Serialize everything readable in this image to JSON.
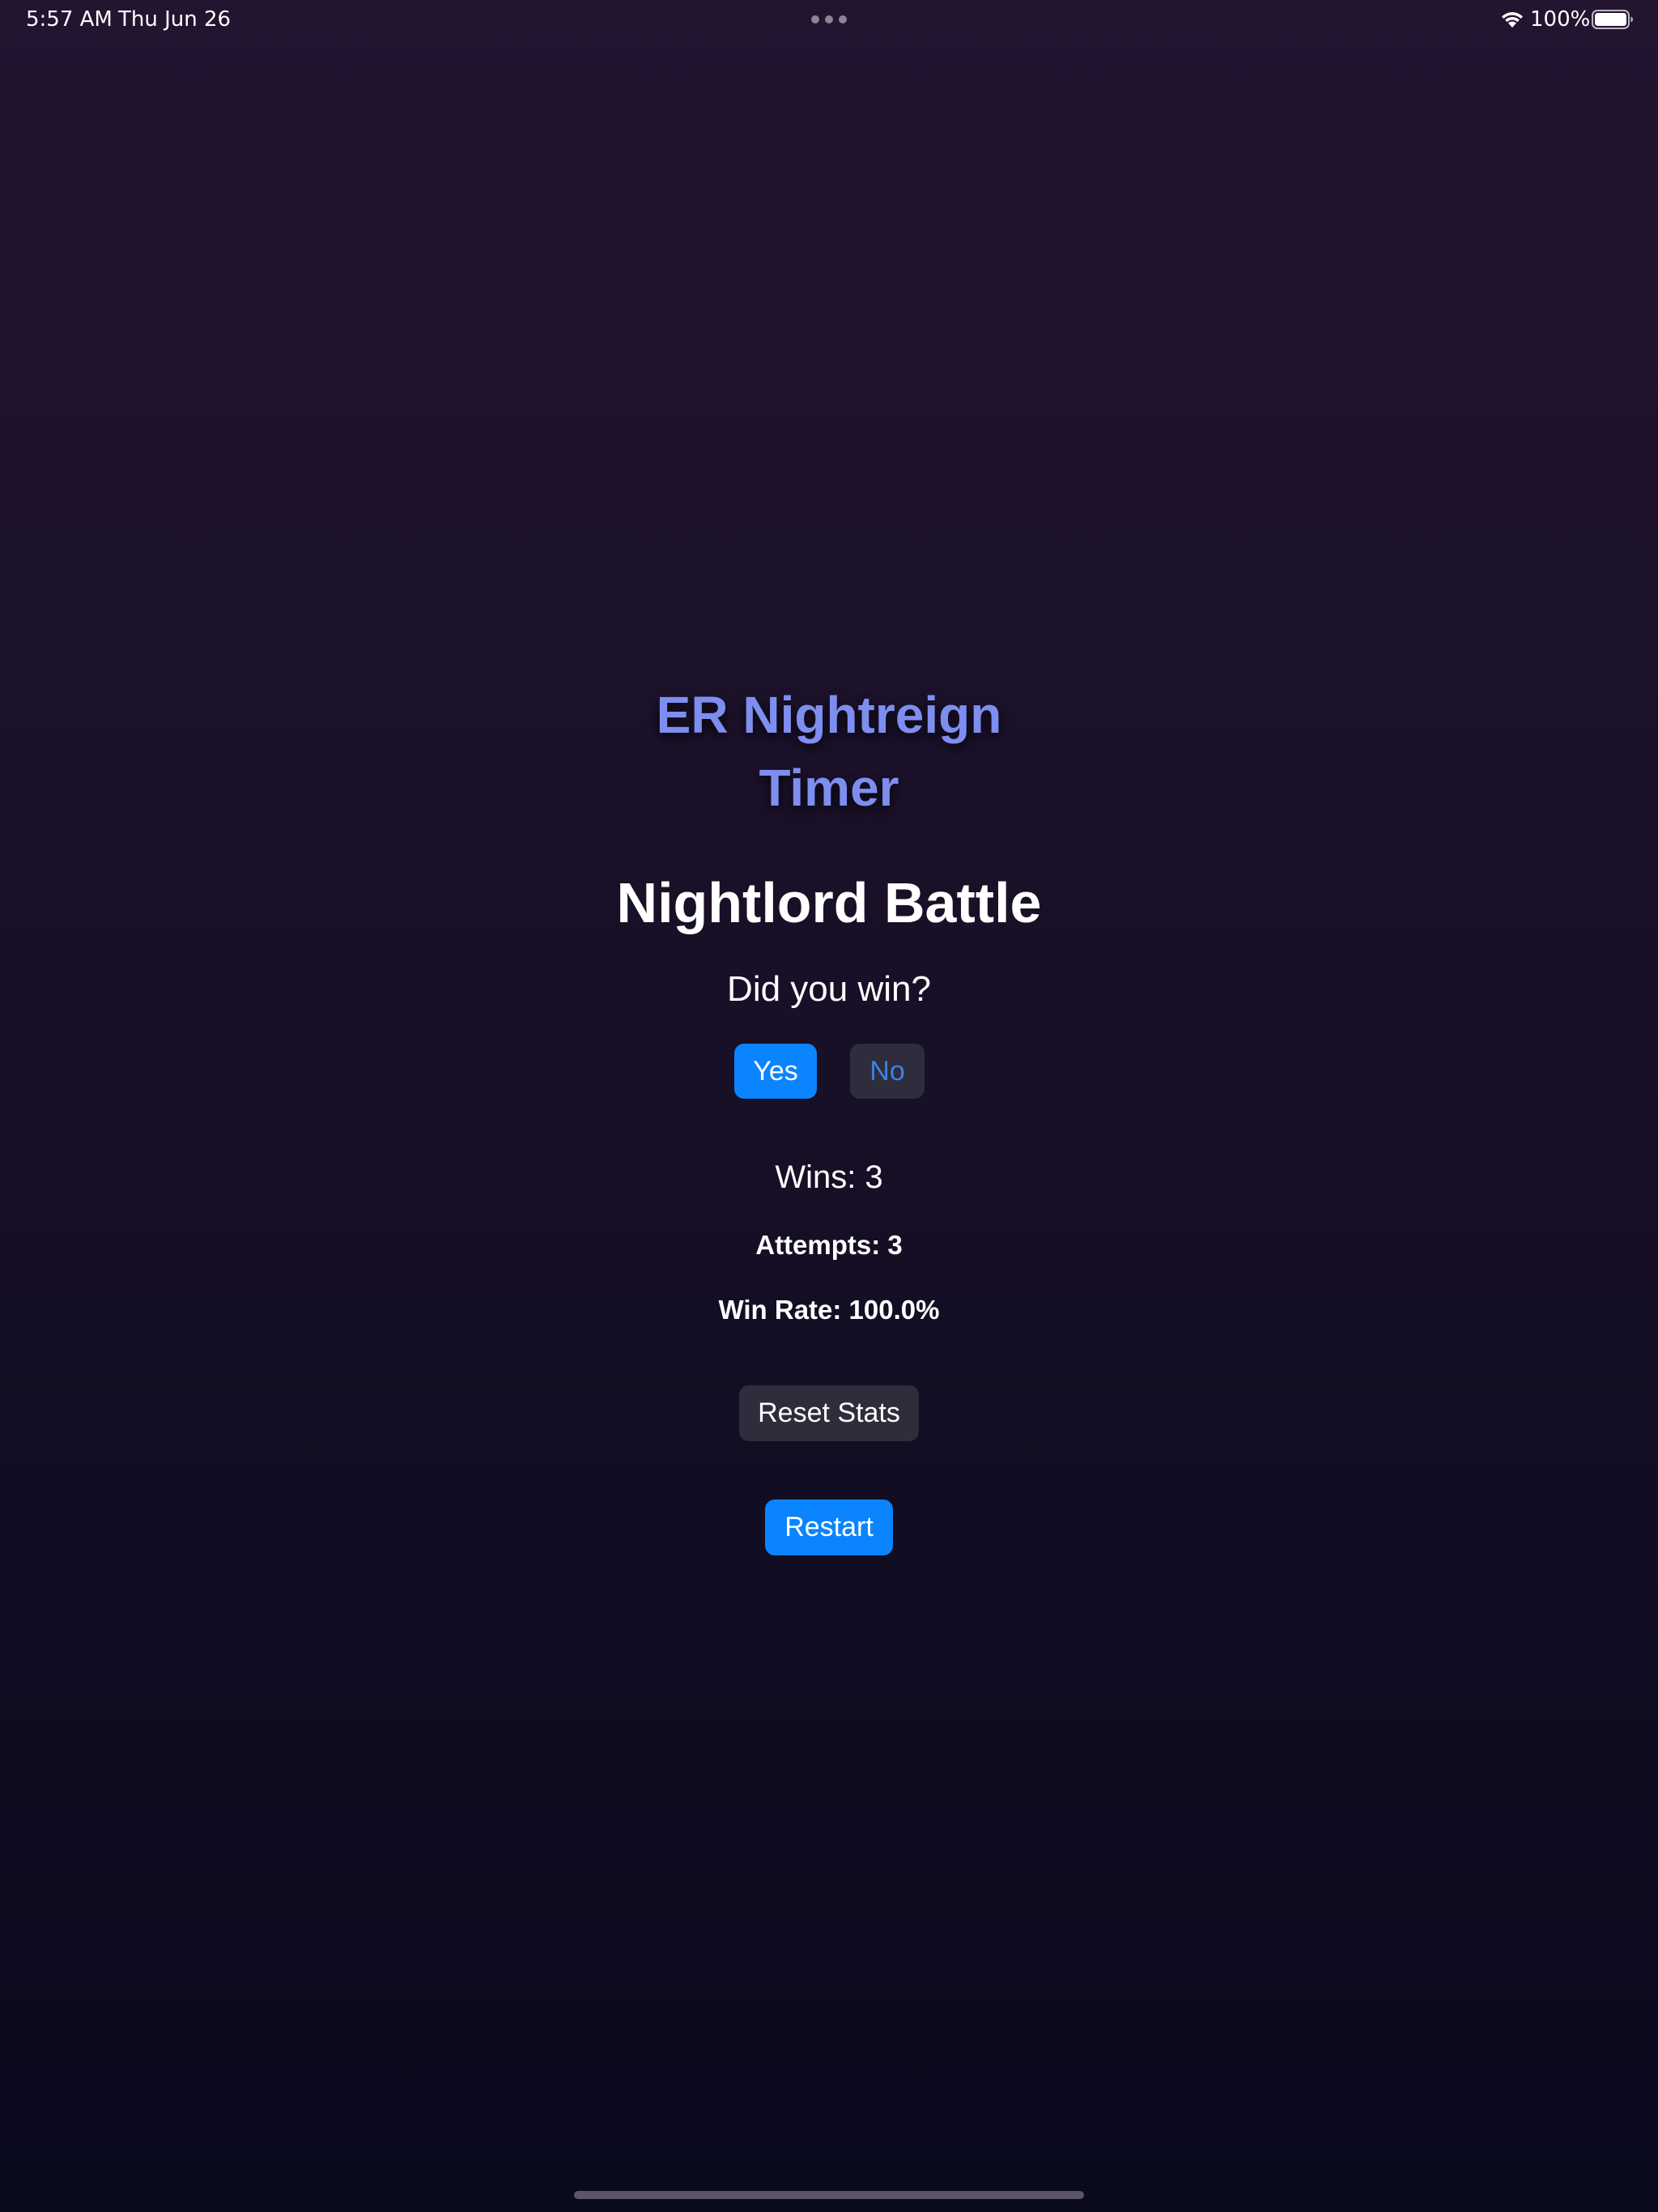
{
  "status_bar": {
    "time": "5:57 AM",
    "date": "Thu Jun 26",
    "battery_percent": "100%",
    "icons": [
      "multitasking-dots-icon",
      "wifi-icon",
      "battery-icon"
    ]
  },
  "app": {
    "title": "ER Nightreign Timer",
    "title_color": "#7e8ef0"
  },
  "screen": {
    "title": "Nightlord Battle",
    "question": "Did you win?"
  },
  "buttons": {
    "yes_label": "Yes",
    "no_label": "No",
    "reset_label": "Reset Stats",
    "restart_label": "Restart"
  },
  "stats": {
    "wins": "Wins: 3",
    "attempts": "Attempts: 3",
    "win_rate": "Win Rate: 100.0%"
  },
  "colors": {
    "accent": "#0a84ff",
    "secondary_button": "#2f2c3c",
    "background_top": "#231430",
    "background_bottom": "#0a0a1d"
  }
}
